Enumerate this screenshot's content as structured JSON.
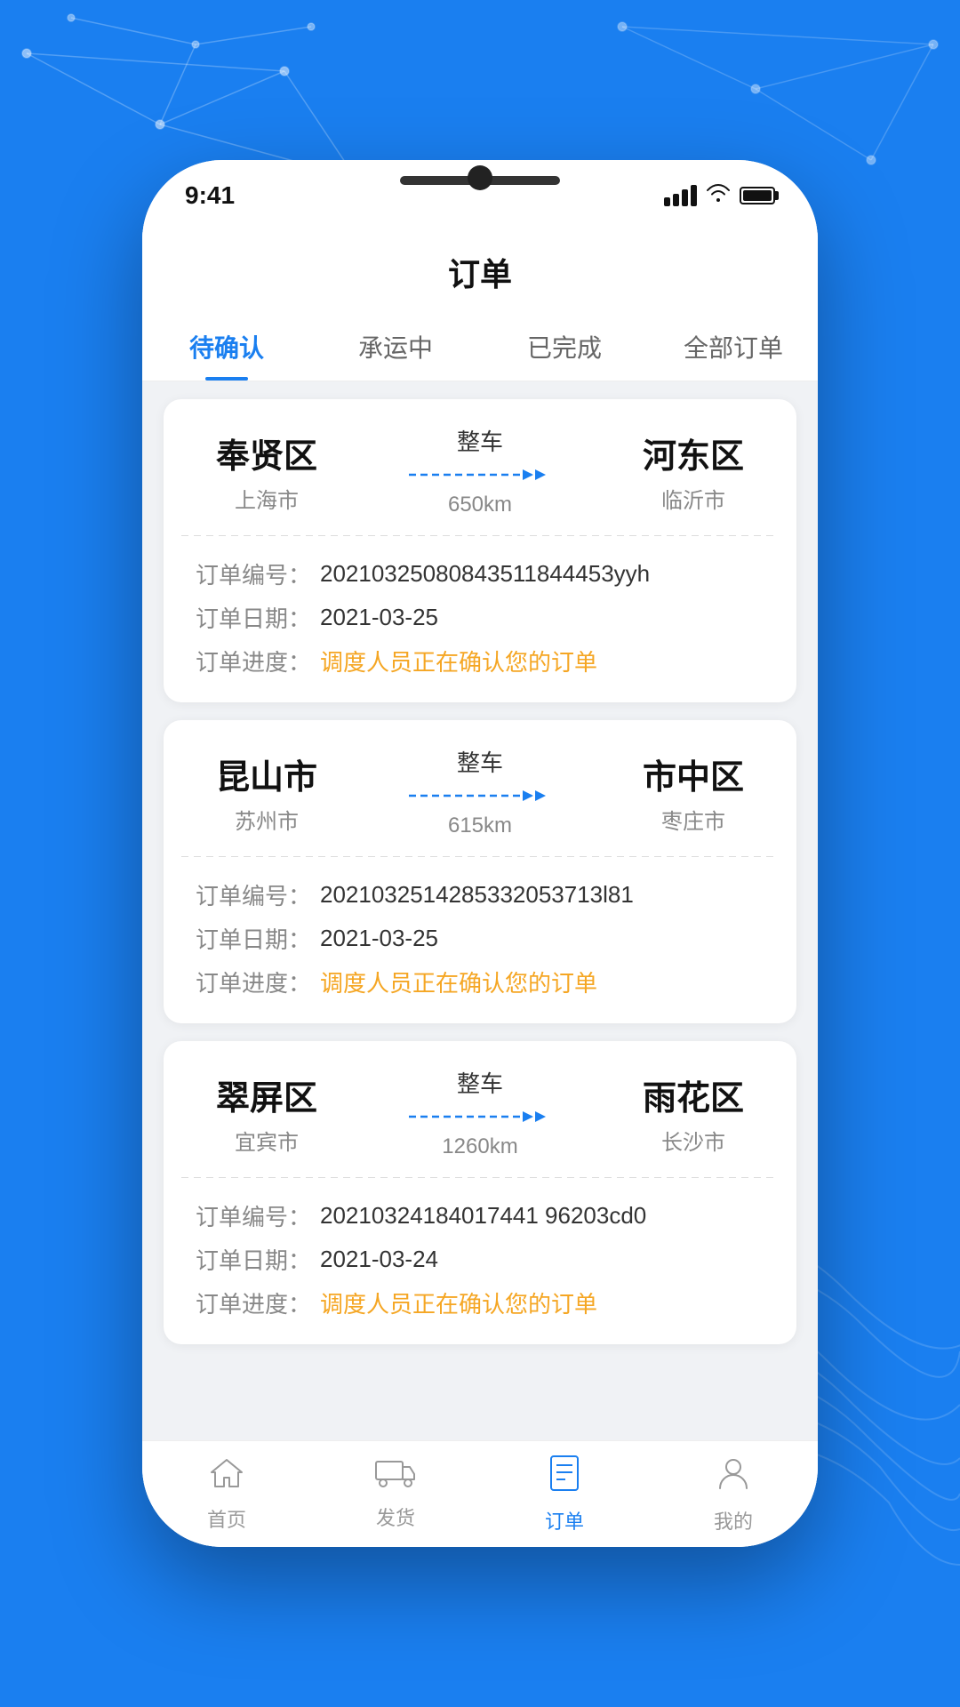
{
  "background": {
    "color": "#1a7ff0"
  },
  "status_bar": {
    "time": "9:41",
    "signal": "full",
    "wifi": true,
    "battery": "full"
  },
  "page": {
    "title": "订单"
  },
  "tabs": [
    {
      "id": "pending",
      "label": "待确认",
      "active": true
    },
    {
      "id": "transit",
      "label": "承运中",
      "active": false
    },
    {
      "id": "completed",
      "label": "已完成",
      "active": false
    },
    {
      "id": "all",
      "label": "全部订单",
      "active": false
    }
  ],
  "orders": [
    {
      "from_city": "奉贤区",
      "from_region": "上海市",
      "to_city": "河东区",
      "to_region": "临沂市",
      "cargo_type": "整车",
      "distance": "650km",
      "order_no_label": "订单编号：",
      "order_no": "20210325080843511844 53yyh",
      "order_no_val": "20210325080843511844 53yyh",
      "order_date_label": "订单日期：",
      "order_date": "2021-03-25",
      "order_progress_label": "订单进度：",
      "order_progress": "调度人员正在确认您的订单"
    },
    {
      "from_city": "昆山市",
      "from_region": "苏州市",
      "to_city": "市中区",
      "to_region": "枣庄市",
      "cargo_type": "整车",
      "distance": "615km",
      "order_no_label": "订单编号：",
      "order_no": "202103251428533 2053713l81",
      "order_no_val": "202103251428533 2053713l81",
      "order_date_label": "订单日期：",
      "order_date": "2021-03-25",
      "order_progress_label": "订单进度：",
      "order_progress": "调度人员正在确认您的订单"
    },
    {
      "from_city": "翠屏区",
      "from_region": "宜宾市",
      "to_city": "雨花区",
      "to_region": "长沙市",
      "cargo_type": "整车",
      "distance": "1260km",
      "order_no_label": "订单编号：",
      "order_no": "20210324184017441 96203cd0",
      "order_no_val": "20210324184017441 96203cd0",
      "order_date_label": "订单日期：",
      "order_date": "2021-03-24",
      "order_progress_label": "订单进度：",
      "order_progress": "调度人员正在确认您的订单"
    }
  ],
  "bottom_nav": [
    {
      "id": "home",
      "label": "首页",
      "active": false,
      "icon": "home"
    },
    {
      "id": "ship",
      "label": "发货",
      "active": false,
      "icon": "truck"
    },
    {
      "id": "order",
      "label": "订单",
      "active": true,
      "icon": "order"
    },
    {
      "id": "profile",
      "label": "我的",
      "active": false,
      "icon": "person"
    }
  ]
}
